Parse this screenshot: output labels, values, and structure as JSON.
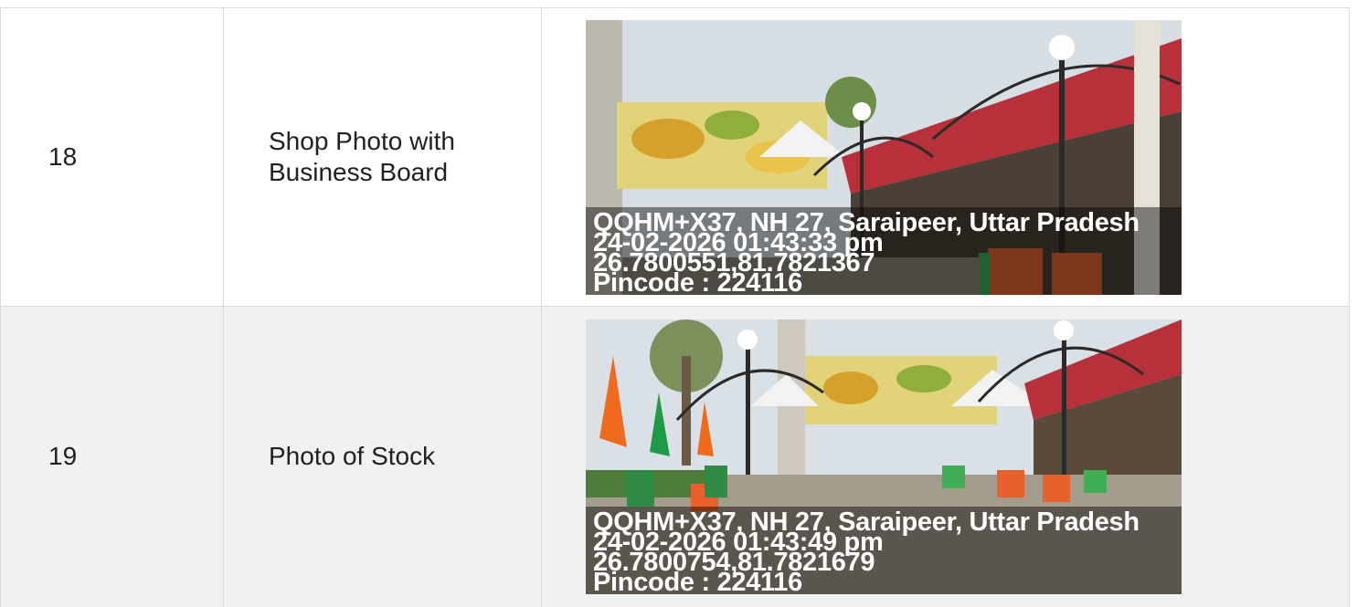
{
  "rows": [
    {
      "number": "18",
      "label_line1": "Shop Photo with",
      "label_line2": "Business Board",
      "stamp": {
        "address": "QQHM+X37, NH 27, Saraipeer, Uttar Pradesh",
        "datetime": "24-02-2026 01:43:33 pm",
        "coords": "26.7800551,81.7821367",
        "pincode": "Pincode : 224116"
      }
    },
    {
      "number": "19",
      "label_line1": "Photo of Stock",
      "label_line2": "",
      "stamp": {
        "address": "QQHM+X37, NH 27, Saraipeer, Uttar Pradesh",
        "datetime": "24-02-2026 01:43:49 pm",
        "coords": "26.7800754,81.7821679",
        "pincode": "Pincode : 224116"
      }
    }
  ],
  "colors": {
    "border": "#dcdcdc",
    "alt_row": "#f1f1f1",
    "sky": "#cfd8de",
    "shop_red": "#b8303a",
    "chair_orange": "#e8612c",
    "chair_green": "#3fae55",
    "flag_saffron": "#f06a1e",
    "flag_green": "#1f9a46"
  }
}
